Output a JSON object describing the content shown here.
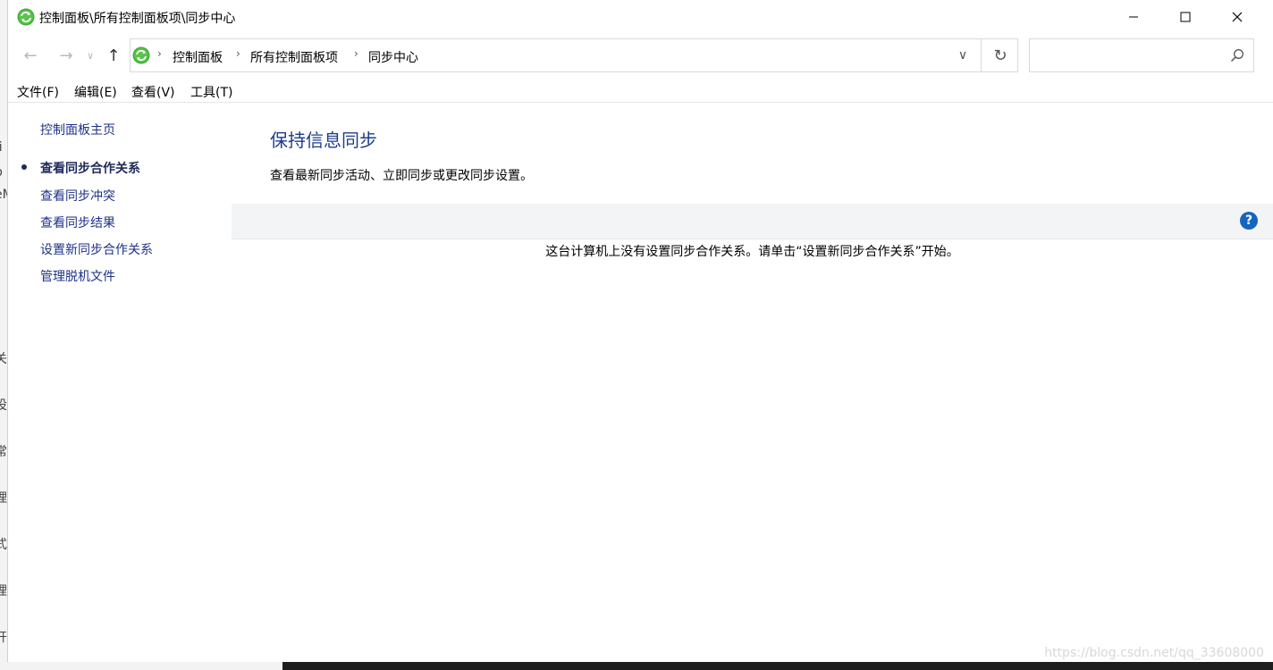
{
  "background_fragments": [
    "/i",
    "p",
    "еM",
    "关",
    "设",
    "常",
    "理",
    "式",
    "理",
    "开"
  ],
  "window": {
    "title": "控制面板\\所有控制面板项\\同步中心",
    "minimize_label": "—",
    "maximize_label": "☐",
    "close_label": "✕"
  },
  "nav": {
    "back_label": "←",
    "forward_label": "→",
    "recent_label": "∨",
    "up_label": "↑",
    "breadcrumb": [
      "控制面板",
      "所有控制面板项",
      "同步中心"
    ],
    "dropdown_label": "∨",
    "refresh_label": "↻",
    "search_value": "",
    "search_placeholder": ""
  },
  "menu": [
    "文件(F)",
    "编辑(E)",
    "查看(V)",
    "工具(T)"
  ],
  "tasks": {
    "home": "控制面板主页",
    "items": [
      "查看同步合作关系",
      "查看同步冲突",
      "查看同步结果",
      "设置新同步合作关系",
      "管理脱机文件"
    ],
    "current_index": 0
  },
  "main": {
    "title": "保持信息同步",
    "description": "查看最新同步活动、立即同步或更改同步设置。",
    "help_label": "?",
    "empty_message": "这台计算机上没有设置同步合作关系。请单击“设置新同步合作关系”开始。"
  },
  "watermark": "https://blog.csdn.net/qq_33608000",
  "colors": {
    "link": "#1e3287",
    "title": "#1e3c8c",
    "help": "#1565c0",
    "sync_icon": "#3fae3a"
  },
  "icons": {
    "app": "sync-center-icon",
    "search": "magnifier-icon"
  }
}
